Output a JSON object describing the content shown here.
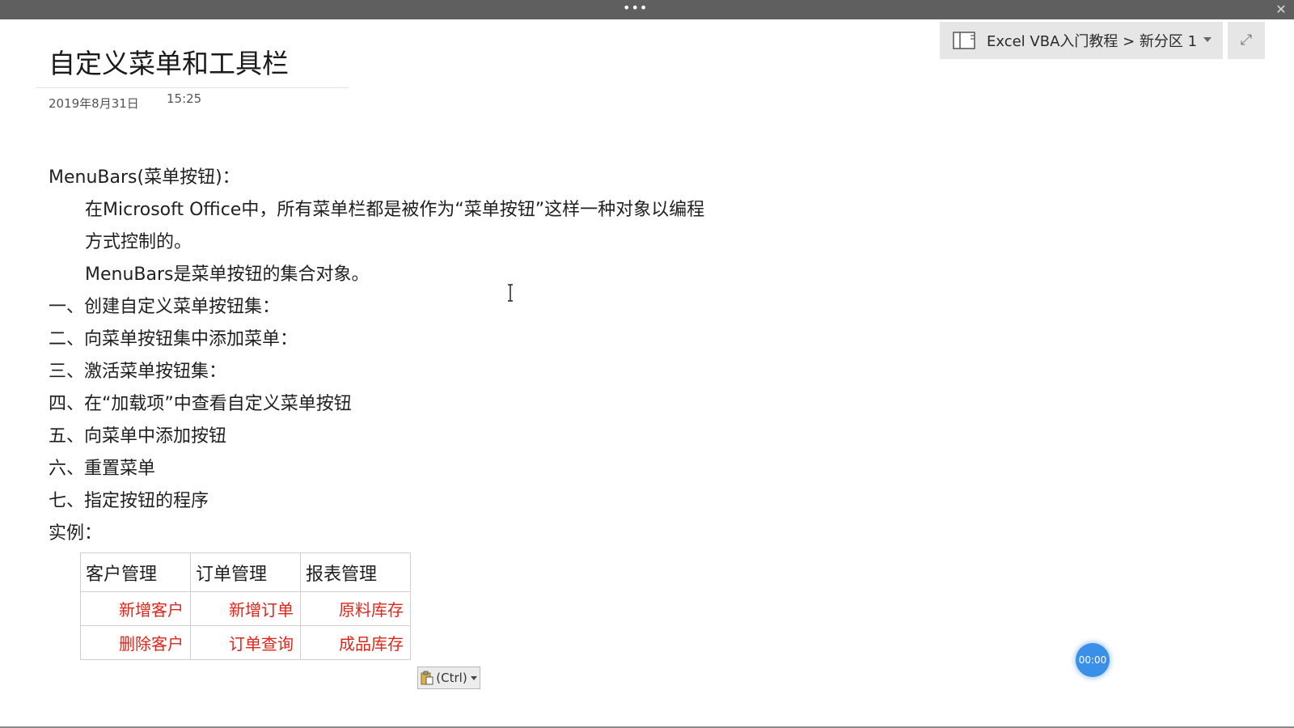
{
  "window": {
    "more_glyph": "•••",
    "close_glyph": "✕"
  },
  "notebook": {
    "path": "Excel VBA入门教程 > 新分区 1",
    "expand_glyph": "⤢"
  },
  "page": {
    "title": "自定义菜单和工具栏",
    "date": "2019年8月31日",
    "time": "15:25"
  },
  "content": {
    "lines": [
      "MenuBars(菜单按钮)：",
      "在Microsoft Office中，所有菜单栏都是被作为“菜单按钮”这样一种对象以编程",
      "方式控制的。",
      "MenuBars是菜单按钮的集合对象。",
      "一、创建自定义菜单按钮集：",
      "二、向菜单按钮集中添加菜单：",
      "三、激活菜单按钮集：",
      "四、在“加载项”中查看自定义菜单按钮",
      "五、向菜单中添加按钮",
      "六、重置菜单",
      "七、指定按钮的程序",
      "实例："
    ]
  },
  "table": {
    "headers": [
      "客户管理",
      "订单管理",
      "报表管理"
    ],
    "rows": [
      [
        "新增客户",
        "新增订单",
        "原料库存"
      ],
      [
        "删除客户",
        "订单查询",
        "成品库存"
      ]
    ],
    "item_color": "#e0251b"
  },
  "paste_options": {
    "label": "(Ctrl)"
  },
  "timer": {
    "value": "00:00"
  }
}
